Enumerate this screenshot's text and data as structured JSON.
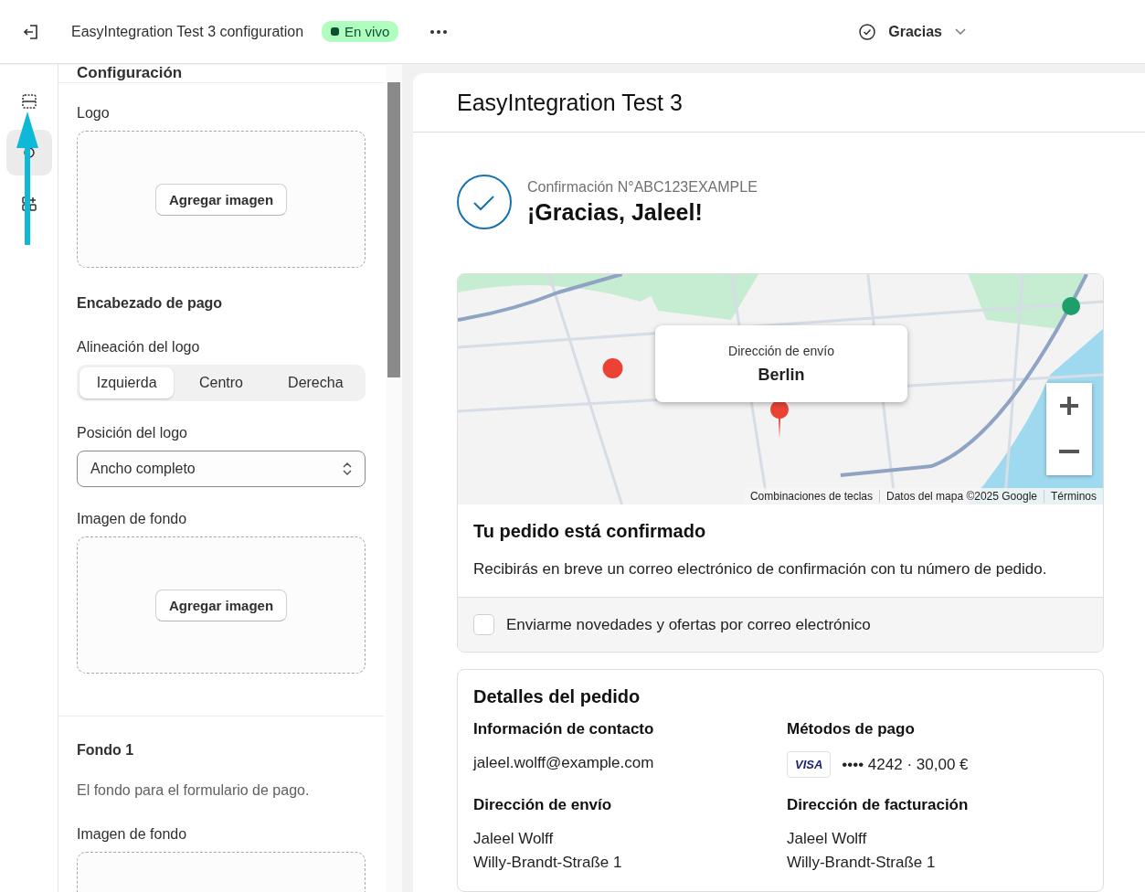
{
  "top_bar": {
    "title": "EasyIntegration Test 3 configuration",
    "status": {
      "label": "En vivo",
      "color": "#0c5132"
    },
    "page_selector": {
      "label": "Gracias"
    }
  },
  "rail": {
    "items": [
      {
        "selected": false
      },
      {
        "selected": true
      },
      {
        "selected": false
      }
    ]
  },
  "settings": {
    "title": "Configuración",
    "sections": [
      {
        "fields": [
          {
            "kind": "upload",
            "label": "Logo",
            "button": "Agregar imagen"
          },
          {
            "kind": "heading",
            "text": "Encabezado de pago"
          },
          {
            "kind": "segmented",
            "label": "Alineación del logo",
            "options": [
              {
                "label": "Izquierda",
                "selected": true
              },
              {
                "label": "Centro",
                "selected": false
              },
              {
                "label": "Derecha",
                "selected": false
              }
            ]
          },
          {
            "kind": "select",
            "label": "Posición del logo",
            "value": "Ancho completo"
          },
          {
            "kind": "upload",
            "label": "Imagen de fondo",
            "button": "Agregar imagen"
          }
        ]
      },
      {
        "fields": [
          {
            "kind": "heading",
            "text": "Fondo 1"
          },
          {
            "kind": "text",
            "text": "El fondo para el formulario de pago."
          },
          {
            "kind": "upload",
            "label": "Imagen de fondo"
          }
        ]
      }
    ]
  },
  "preview": {
    "shop_name": "EasyIntegration Test 3",
    "confirmation": "Confirmación N°ABC123EXAMPLE",
    "greeting": "¡Gracias, Jaleel!",
    "map": {
      "popup_label": "Dirección de envío",
      "popup_value": "Berlin",
      "attribution": [
        "Combinaciones de teclas",
        "Datos del mapa ©2025 Google",
        "Términos"
      ]
    },
    "confirmed": {
      "title": "Tu pedido está confirmado",
      "text": "Recibirás en breve un correo electrónico de confirmación con tu número de pedido."
    },
    "newsletter": {
      "label": "Enviarme novedades y ofertas por correo electrónico",
      "checked": false
    },
    "details": {
      "title": "Detalles del pedido",
      "blocks": [
        {
          "kind": "text",
          "heading": "Información de contacto",
          "lines": [
            "jaleel.wolff@example.com"
          ]
        },
        {
          "kind": "payment",
          "heading": "Métodos de pago",
          "card": "VISA",
          "lines": [
            "•••• 4242 · 30,00 €"
          ]
        },
        {
          "kind": "text",
          "heading": "Dirección de envío",
          "lines": [
            "Jaleel Wolff",
            "Willy-Brandt-Straße 1"
          ]
        },
        {
          "kind": "text",
          "heading": "Dirección de facturación",
          "lines": [
            "Jaleel Wolff",
            "Willy-Brandt-Straße 1"
          ]
        }
      ]
    }
  }
}
